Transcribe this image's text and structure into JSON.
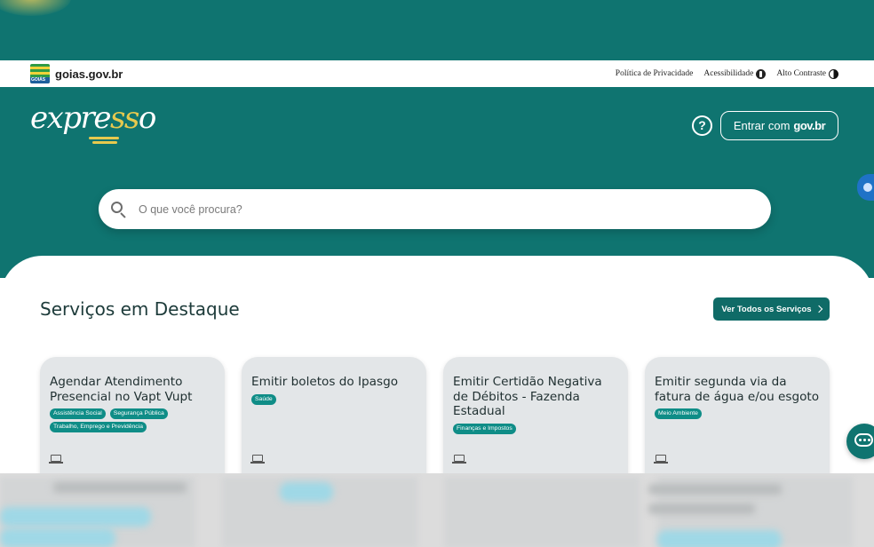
{
  "gov_bar": {
    "site": "goias.gov.br",
    "flag_badge": "GOIÁS",
    "links": {
      "privacy": "Política de Privacidade",
      "accessibility": "Acessibilidade",
      "high_contrast": "Alto Contraste"
    }
  },
  "header": {
    "logo_left": "expre",
    "logo_ss": "ss",
    "logo_right": "o",
    "login_prefix": "Entrar com",
    "login_brand": "gov.br",
    "help_glyph": "?"
  },
  "search": {
    "placeholder": "O que você procura?"
  },
  "featured": {
    "title": "Serviços em Destaque",
    "see_all": "Ver Todos os Serviços",
    "cards": [
      {
        "title": "Agendar Atendimento Presencial no Vapt Vupt",
        "tags": [
          "Assistência Social",
          "Segurança Pública",
          "Trabalho, Emprego e Previdência"
        ],
        "icon": "laptop-icon"
      },
      {
        "title": "Emitir boletos do Ipasgo",
        "tags": [
          "Saúde"
        ],
        "icon": "laptop-icon"
      },
      {
        "title": "Emitir Certidão Negativa de Débitos - Fazenda Estadual",
        "tags": [
          "Finanças e Impostos"
        ],
        "icon": "laptop-icon"
      },
      {
        "title": "Emitir segunda via da fatura de água e/ou esgoto",
        "tags": [
          "Meio Ambiente"
        ],
        "icon": "laptop-icon"
      }
    ]
  },
  "colors": {
    "primary": "#0f7470",
    "button": "#0f6b67",
    "tag": "#0f8d87",
    "accent_logo": "#e7c94e",
    "card_bg": "#e3e6e8"
  }
}
